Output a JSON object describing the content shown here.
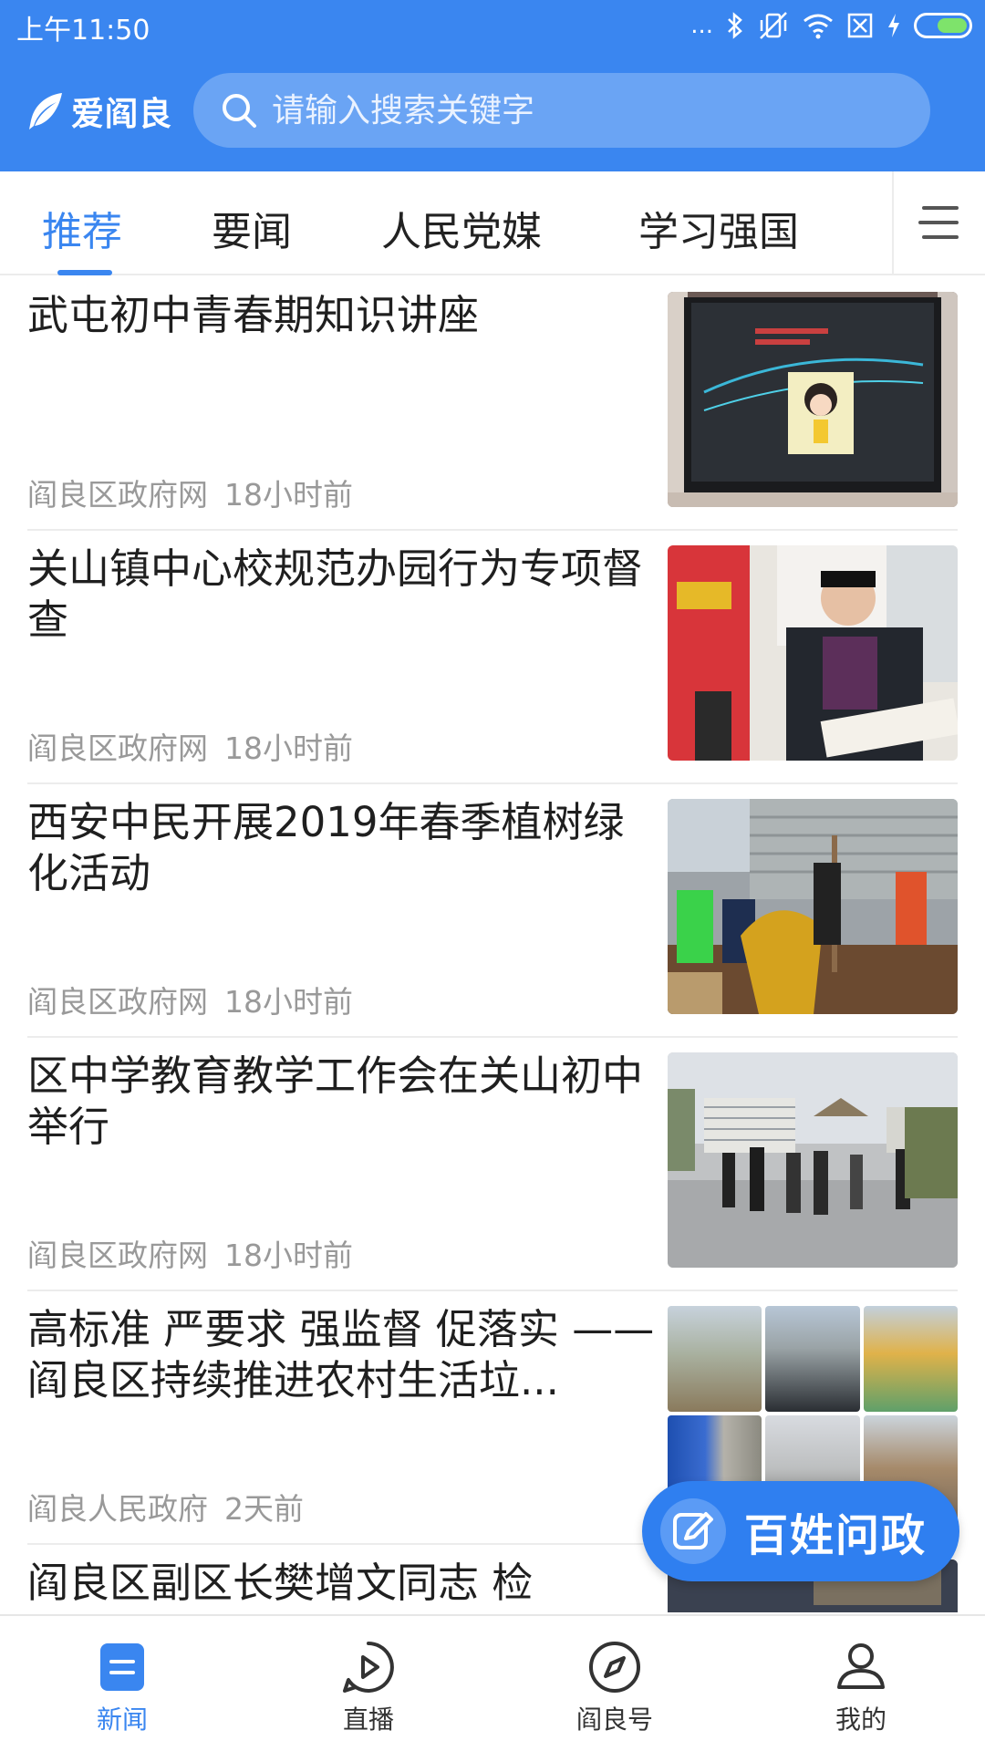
{
  "status_bar": {
    "time": "上午11:50",
    "dots": "...",
    "icons": [
      "bluetooth-icon",
      "vibrate-icon",
      "wifi-icon",
      "sim-icon",
      "charging-icon",
      "battery-icon"
    ]
  },
  "header": {
    "logo_text": "爱阎良",
    "search_placeholder": "请输入搜索关键字",
    "color": "#3a86f0"
  },
  "tabs": [
    {
      "label": "推荐",
      "active": true
    },
    {
      "label": "要闻",
      "active": false
    },
    {
      "label": "人民党媒",
      "active": false
    },
    {
      "label": "学习强国",
      "active": false
    }
  ],
  "news": [
    {
      "title": "武屯初中青春期知识讲座",
      "source": "阎良区政府网",
      "time": "18小时前"
    },
    {
      "title": "关山镇中心校规范办园行为专项督查",
      "source": "阎良区政府网",
      "time": "18小时前"
    },
    {
      "title": "西安中民开展2019年春季植树绿化活动",
      "source": "阎良区政府网",
      "time": "18小时前"
    },
    {
      "title": "区中学教育教学工作会在关山初中举行",
      "source": "阎良区政府网",
      "time": "18小时前"
    },
    {
      "title": "高标准 严要求 强监督 促落实 ——阎良区持续推进农村生活垃...",
      "source": "阎良人民政府",
      "time": "2天前"
    },
    {
      "title": "阎良区副区长樊增文同志 检",
      "source": "",
      "time": ""
    }
  ],
  "fab": {
    "label": "百姓问政"
  },
  "bottom_nav": [
    {
      "label": "新闻",
      "icon": "news-icon",
      "active": true
    },
    {
      "label": "直播",
      "icon": "play-icon",
      "active": false
    },
    {
      "label": "阎良号",
      "icon": "compass-icon",
      "active": false
    },
    {
      "label": "我的",
      "icon": "user-icon",
      "active": false
    }
  ]
}
